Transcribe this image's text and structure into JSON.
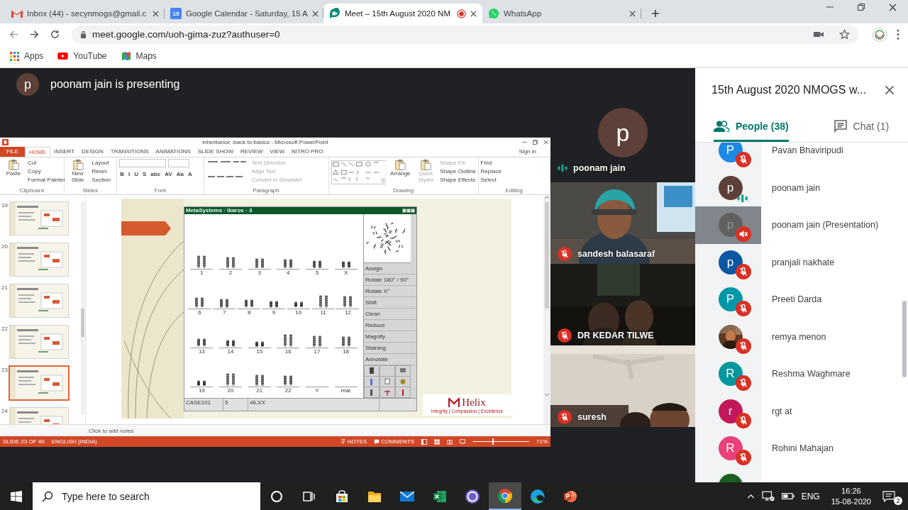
{
  "browser": {
    "tabs": [
      {
        "kind": "gmail",
        "title": "Inbox (44) - secynmogs@gmail.c",
        "selected": false
      },
      {
        "kind": "calendar",
        "badge": "15",
        "title": "Google Calendar - Saturday, 15 A",
        "selected": false
      },
      {
        "kind": "meet",
        "title": "Meet – 15th August 2020 NM",
        "recording": true,
        "selected": true
      },
      {
        "kind": "whatsapp",
        "title": "WhatsApp",
        "selected": false
      }
    ],
    "address": "meet.google.com/uoh-gima-zuz?authuser=0",
    "bookmarks": [
      {
        "kind": "apps",
        "label": "Apps"
      },
      {
        "kind": "youtube",
        "label": "YouTube"
      },
      {
        "kind": "maps",
        "label": "Maps"
      }
    ]
  },
  "meet": {
    "presenter": {
      "initial": "p",
      "text": "poonam jain is presenting"
    },
    "tiles": [
      {
        "initial": "p",
        "name": "poonam jain",
        "kind": "speaking"
      },
      {
        "name": "sandesh balasaraf",
        "kind": "muted"
      },
      {
        "name": "DR KEDAR TILWE",
        "kind": "muted"
      },
      {
        "name": "suresh",
        "kind": "muted"
      }
    ]
  },
  "powerpoint": {
    "title": "inheritance -back to basics - Microsoft PowerPoint",
    "tabs": [
      {
        "label": "FILE",
        "kind": "file",
        "selected": false
      },
      {
        "label": "HOME",
        "kind": "tab",
        "selected": true
      },
      {
        "label": "INSERT",
        "kind": "tab",
        "selected": false
      },
      {
        "label": "DESIGN",
        "kind": "tab",
        "selected": false
      },
      {
        "label": "TRANSITIONS",
        "kind": "tab",
        "selected": false
      },
      {
        "label": "ANIMATIONS",
        "kind": "tab",
        "selected": false
      },
      {
        "label": "SLIDE SHOW",
        "kind": "tab",
        "selected": false
      },
      {
        "label": "REVIEW",
        "kind": "tab",
        "selected": false
      },
      {
        "label": "VIEW",
        "kind": "tab",
        "selected": false
      },
      {
        "label": "NITRO PRO",
        "kind": "tab",
        "selected": false
      }
    ],
    "sign_in": "Sign in",
    "groups": [
      {
        "kind": "clipboard",
        "label": "Clipboard",
        "items": [
          {
            "label": "Paste",
            "kind": "large",
            "disabled": false
          },
          {
            "label": "Cut",
            "kind": "small",
            "disabled": false
          },
          {
            "label": "Copy",
            "kind": "small",
            "disabled": false
          },
          {
            "label": "Format Painter",
            "kind": "small",
            "disabled": false
          }
        ]
      },
      {
        "kind": "slides",
        "label": "Slides",
        "items": [
          {
            "label": "New Slide",
            "kind": "large",
            "disabled": false
          },
          {
            "label": "Layout",
            "kind": "small",
            "disabled": false
          },
          {
            "label": "Reset",
            "kind": "small",
            "disabled": false
          },
          {
            "label": "Section",
            "kind": "small",
            "disabled": false
          }
        ]
      },
      {
        "kind": "font",
        "label": "Font",
        "items": [
          {
            "label": "B",
            "kind": "glyph",
            "disabled": false
          },
          {
            "label": "I",
            "kind": "glyph",
            "disabled": false
          },
          {
            "label": "U",
            "kind": "glyph",
            "disabled": false
          },
          {
            "label": "S",
            "kind": "glyph",
            "disabled": false
          },
          {
            "label": "abc",
            "kind": "glyph",
            "disabled": false
          },
          {
            "label": "AV",
            "kind": "glyph",
            "disabled": false
          },
          {
            "label": "Aa",
            "kind": "glyph",
            "disabled": false
          },
          {
            "label": "A",
            "kind": "glyph",
            "disabled": false
          }
        ]
      },
      {
        "kind": "paragraph",
        "label": "Paragraph",
        "items": [
          {
            "label": "Text Direction",
            "kind": "small",
            "disabled": true
          },
          {
            "label": "Align Text",
            "kind": "small",
            "disabled": true
          },
          {
            "label": "Convert to SmartArt",
            "kind": "small",
            "disabled": true
          }
        ]
      },
      {
        "kind": "drawing",
        "label": "Drawing",
        "items": [
          {
            "label": "Arrange",
            "kind": "large",
            "disabled": false
          },
          {
            "label": "Quick Styles",
            "kind": "large",
            "disabled": true
          },
          {
            "label": "Shape Fill",
            "kind": "small",
            "disabled": true
          },
          {
            "label": "Shape Outline",
            "kind": "small",
            "disabled": false
          },
          {
            "label": "Shape Effects",
            "kind": "small",
            "disabled": false
          }
        ]
      },
      {
        "kind": "editing",
        "label": "Editing",
        "items": [
          {
            "label": "Find",
            "kind": "small",
            "disabled": false
          },
          {
            "label": "Replace",
            "kind": "small",
            "disabled": false
          },
          {
            "label": "Select",
            "kind": "small",
            "disabled": false
          }
        ]
      }
    ],
    "slides": [
      {
        "number": "19",
        "selected": false
      },
      {
        "number": "20",
        "selected": false
      },
      {
        "number": "21",
        "selected": false
      },
      {
        "number": "22",
        "selected": false
      },
      {
        "number": "23",
        "selected": true
      },
      {
        "number": "24",
        "selected": false
      }
    ],
    "karyotype": {
      "title": "MetaSystems · Ikaros · 3",
      "rows": [
        [
          {
            "label": "1",
            "empty": false
          },
          {
            "label": "2",
            "empty": false
          },
          {
            "label": "3",
            "empty": false
          },
          {
            "label": "4",
            "empty": false
          },
          {
            "label": "5",
            "empty": false
          },
          {
            "label": "X",
            "empty": false
          }
        ],
        [
          {
            "label": "6",
            "empty": false
          },
          {
            "label": "7",
            "empty": false
          },
          {
            "label": "8",
            "empty": false
          },
          {
            "label": "9",
            "empty": false
          },
          {
            "label": "10",
            "empty": false
          },
          {
            "label": "11",
            "empty": false
          },
          {
            "label": "12",
            "empty": false
          }
        ],
        [
          {
            "label": "13",
            "empty": false
          },
          {
            "label": "14",
            "empty": false
          },
          {
            "label": "15",
            "empty": false
          },
          {
            "label": "16",
            "empty": false
          },
          {
            "label": "17",
            "empty": false
          },
          {
            "label": "18",
            "empty": false
          }
        ],
        [
          {
            "label": "19",
            "empty": false
          },
          {
            "label": "20",
            "empty": false
          },
          {
            "label": "21",
            "empty": false
          },
          {
            "label": "22",
            "empty": false
          },
          {
            "label": "Y",
            "empty": true
          },
          {
            "label": "mar",
            "empty": true
          }
        ]
      ],
      "tools": [
        "Assign",
        "Rotate 180° / 90°",
        "Rotate X°",
        "Shift",
        "Clean",
        "Reduce",
        "Magnify",
        "Staining",
        "Annotate"
      ],
      "case": [
        "CASE101",
        "5",
        "46,XX"
      ]
    },
    "logo": {
      "name": "Helix",
      "tagline": "Integrity | Compassion | Excellence"
    },
    "notes": {
      "placeholder": "Click to add notes"
    },
    "status": {
      "slide": "SLIDE 23 OF 40",
      "language": "ENGLISH (INDIA)",
      "notes": "NOTES",
      "comments": "COMMENTS",
      "zoom": "71%",
      "level": 0.35
    }
  },
  "panel": {
    "title": "15th August 2020 NMOGS w...",
    "tabs": [
      {
        "kind": "people",
        "label": "People (38)",
        "selected": true
      },
      {
        "kind": "chat",
        "label": "Chat (1)",
        "selected": false
      }
    ],
    "people": [
      {
        "photo": false,
        "initial": "P",
        "color": "#1e88e5",
        "name": "Pavan Bhaviripudi",
        "kind": "muted",
        "selected": false
      },
      {
        "photo": false,
        "initial": "p",
        "color": "#5d4037",
        "name": "poonam jain",
        "kind": "speaking",
        "selected": false
      },
      {
        "photo": false,
        "initial": "p",
        "color": "#616161",
        "name": "poonam jain (Presentation)",
        "kind": "sound_off",
        "selected": true
      },
      {
        "photo": false,
        "initial": "p",
        "color": "#0b57a4",
        "name": "pranjali nakhate",
        "kind": "muted",
        "selected": false
      },
      {
        "photo": false,
        "initial": "P",
        "color": "#0097a7",
        "name": "Preeti Darda",
        "kind": "muted",
        "selected": false
      },
      {
        "photo": true,
        "name": "remya menon",
        "kind": "muted",
        "selected": false
      },
      {
        "photo": false,
        "initial": "R",
        "color": "#00969e",
        "name": "Reshma Waghmare",
        "kind": "muted",
        "selected": false
      },
      {
        "photo": false,
        "initial": "r",
        "color": "#c2185b",
        "name": "rgt at",
        "kind": "muted",
        "selected": false
      },
      {
        "photo": false,
        "initial": "R",
        "color": "#ec407a",
        "name": "Rohini Mahajan",
        "kind": "muted",
        "selected": false
      },
      {
        "photo": false,
        "color": "#1b5e20",
        "selected": false
      }
    ]
  },
  "taskbar": {
    "search": {
      "placeholder": "Type here to search"
    },
    "apps": [
      {
        "kind": "cortana",
        "active": false
      },
      {
        "kind": "taskview",
        "active": false
      },
      {
        "kind": "store",
        "active": false
      },
      {
        "kind": "explorer",
        "active": false
      },
      {
        "kind": "mail",
        "active": false
      },
      {
        "kind": "excel",
        "active": false
      },
      {
        "kind": "chatapp",
        "active": false
      },
      {
        "kind": "chrome",
        "active": true
      },
      {
        "kind": "edge",
        "active": false
      },
      {
        "kind": "powerpoint",
        "active": false
      }
    ],
    "language": "ENG",
    "time": "16:26",
    "date": "15-08-2020",
    "notifications": "2"
  }
}
